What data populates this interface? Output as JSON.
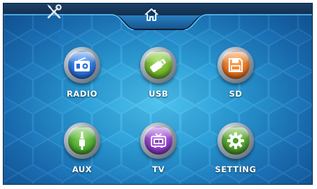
{
  "topbar": {
    "tools_icon": "wrench-screwdriver-icon",
    "home_icon": "home-icon"
  },
  "tiles": [
    {
      "label": "RADIO",
      "icon": "radio-icon",
      "color": "#2a6fd6"
    },
    {
      "label": "USB",
      "icon": "usb-drive-icon",
      "color": "#6fae2a"
    },
    {
      "label": "SD",
      "icon": "floppy-disk-icon",
      "color": "#e0701e"
    },
    {
      "label": "AUX",
      "icon": "aux-plug-icon",
      "color": "#4ca62c"
    },
    {
      "label": "TV",
      "icon": "tv-icon",
      "color": "#8a3cc4"
    },
    {
      "label": "SETTING",
      "icon": "gear-icon",
      "color": "#4e9a2a"
    }
  ],
  "colors": {
    "background": "#2c9fd8",
    "topbar": "#0f2d4f",
    "home_tab": "#1f78bf"
  }
}
